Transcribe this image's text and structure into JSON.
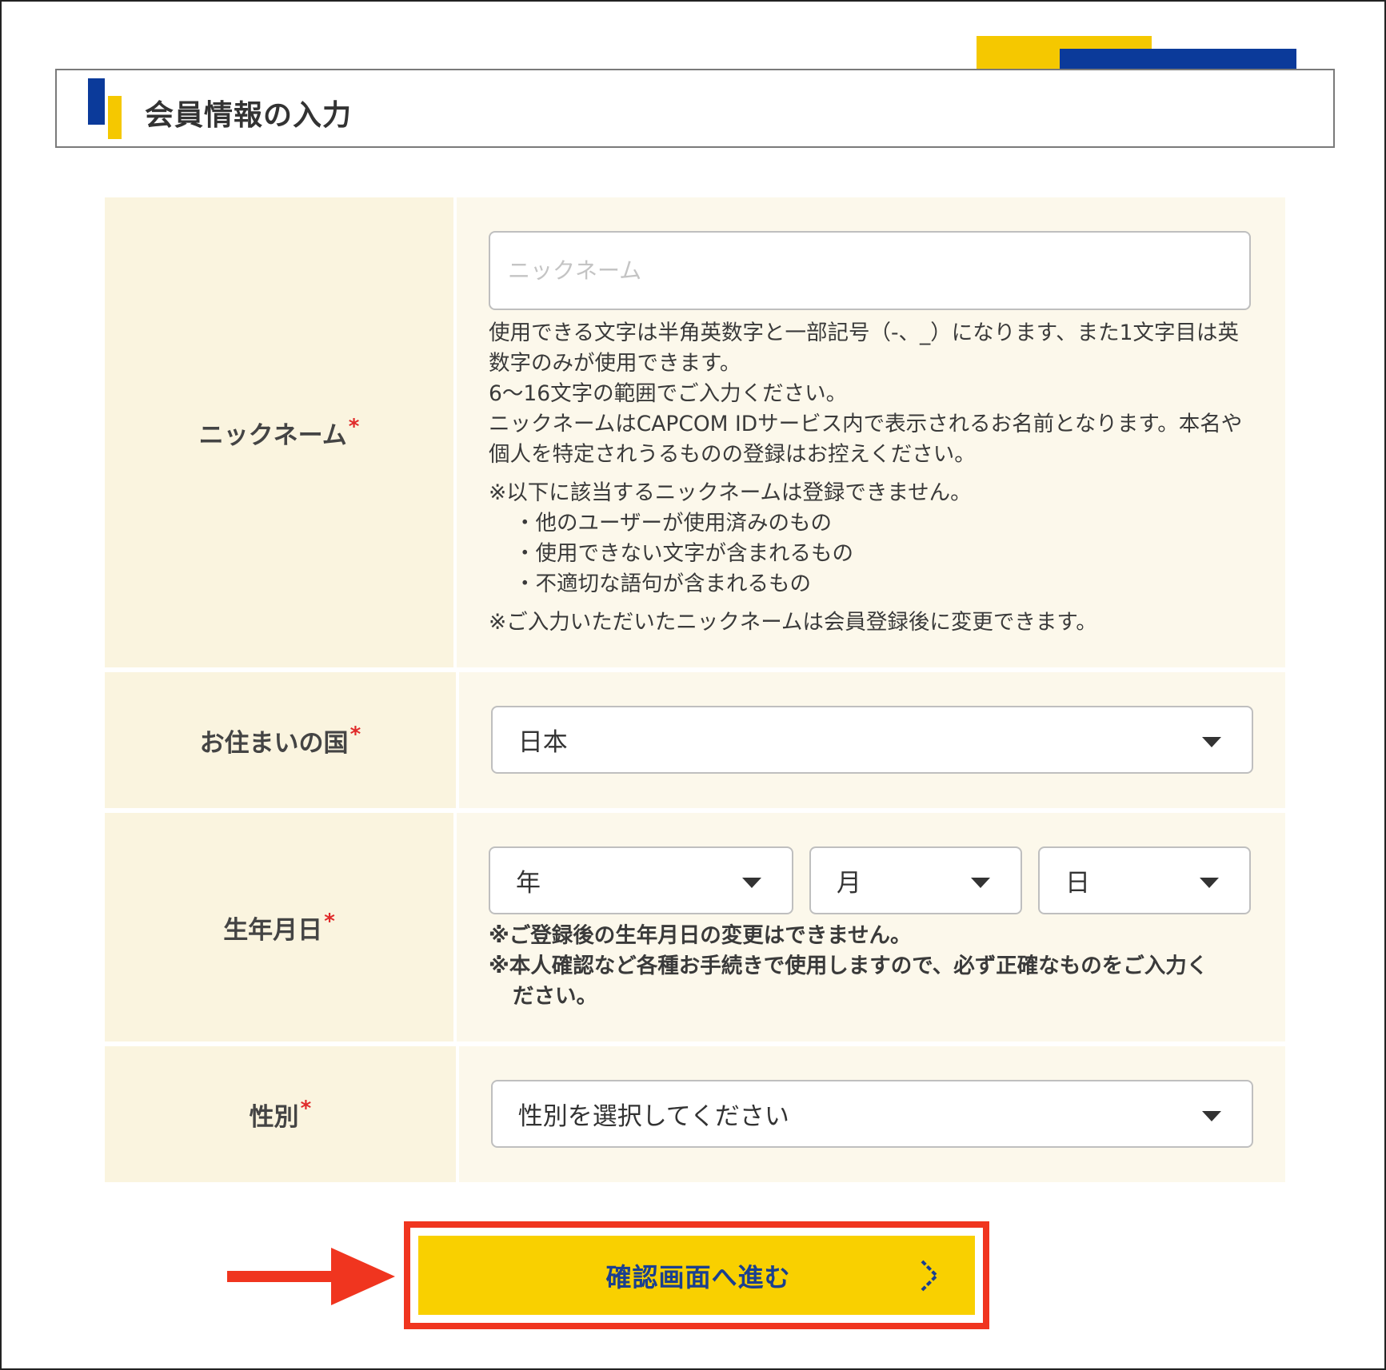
{
  "page": {
    "title": "会員情報の入力"
  },
  "colors": {
    "brand_blue": "#0b3a9a",
    "brand_yellow": "#f5c800",
    "button_yellow": "#f9d000",
    "highlight_red": "#f0351f",
    "required_red": "#e02a2a"
  },
  "form": {
    "required_mark": "*",
    "nickname": {
      "label": "ニックネーム",
      "placeholder": "ニックネーム",
      "value": "",
      "help_lines": [
        "使用できる文字は半角英数字と一部記号（-、_）になります、また1文字目は英数字のみが使用できます。",
        "6〜16文字の範囲でご入力ください。",
        "ニックネームはCAPCOM IDサービス内で表示されるお名前となります。本名や個人を特定されうるものの登録はお控えください。"
      ],
      "restriction_title": "※以下に該当するニックネームは登録できません。",
      "restrictions": [
        "・他のユーザーが使用済みのもの",
        "・使用できない文字が含まれるもの",
        "・不適切な語句が含まれるもの"
      ],
      "change_note": "※ご入力いただいたニックネームは会員登録後に変更できます。"
    },
    "country": {
      "label": "お住まいの国",
      "selected": "日本"
    },
    "birthdate": {
      "label": "生年月日",
      "year": "年",
      "month": "月",
      "day": "日",
      "note_1": "※ご登録後の生年月日の変更はできません。",
      "note_2a": "※本人確認など各種お手続きで使用しますので、必ず正確なものをご入力く",
      "note_2b": "ださい。"
    },
    "gender": {
      "label": "性別",
      "selected": "性別を選択してください"
    }
  },
  "submit": {
    "label": "確認画面へ進む",
    "icon": "chevron-right-icon"
  }
}
